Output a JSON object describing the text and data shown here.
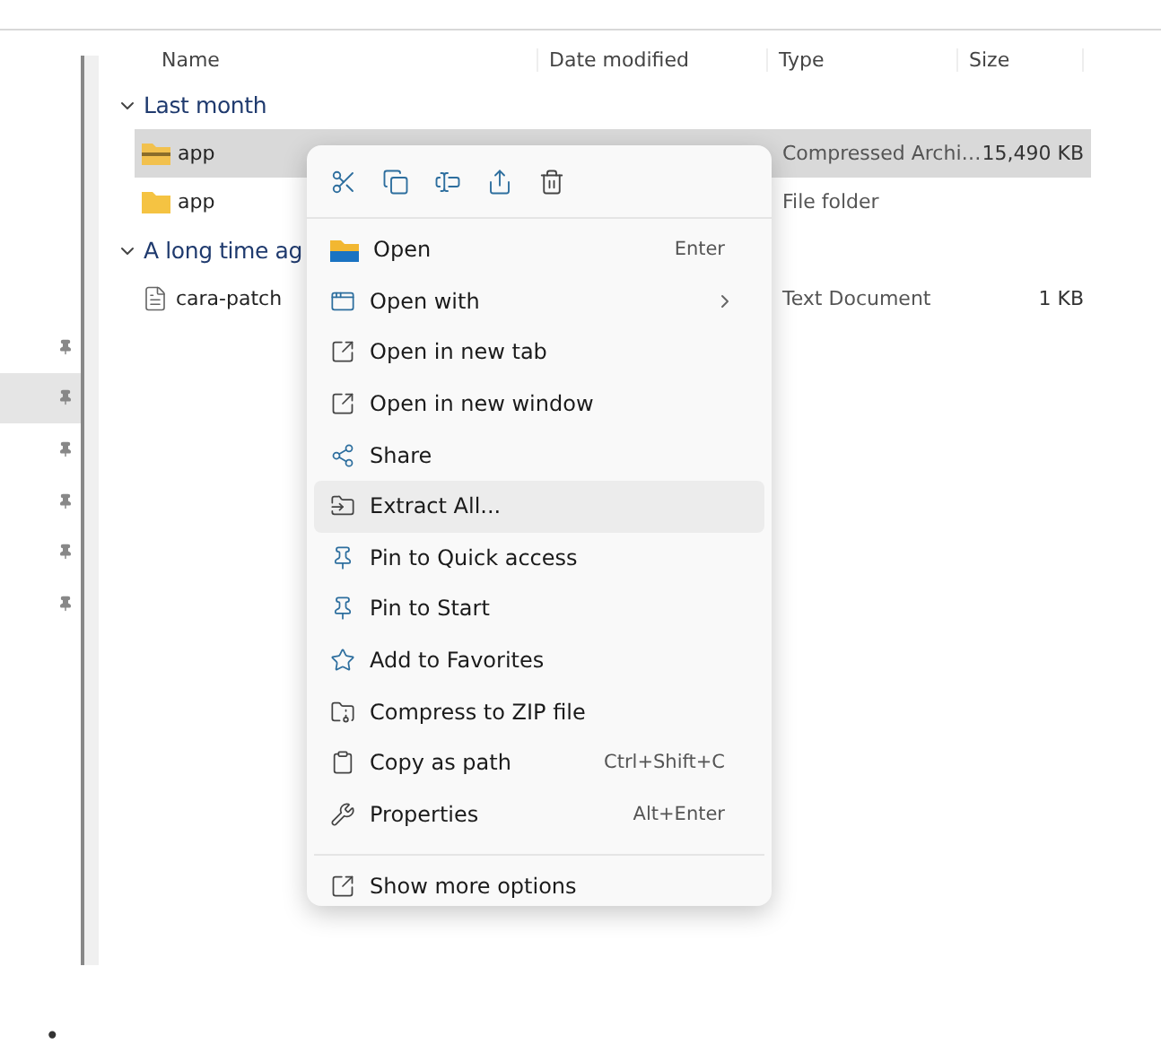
{
  "columns": [
    "Name",
    "Date modified",
    "Type",
    "Size"
  ],
  "groups": [
    {
      "label": "Last month",
      "expanded": true,
      "files": [
        {
          "name": "app",
          "kind": "zip",
          "type": "Compressed Archi…",
          "size": "15,490 KB",
          "selected": true
        },
        {
          "name": "app",
          "kind": "folder",
          "type": "File folder",
          "selected": false
        }
      ]
    },
    {
      "label": "A long time ag",
      "expanded": true,
      "files": [
        {
          "name": "cara-patch",
          "kind": "text",
          "type": "Text Document",
          "size": "1 KB",
          "selected": false
        }
      ]
    }
  ],
  "sidebar_pins": [
    {
      "selected": false
    },
    {
      "selected": true
    },
    {
      "selected": false
    },
    {
      "selected": false
    },
    {
      "selected": false
    },
    {
      "selected": false
    }
  ],
  "context_menu": {
    "toolbar": [
      {
        "kind": "cut"
      },
      {
        "kind": "copy"
      },
      {
        "kind": "rename"
      },
      {
        "kind": "share"
      },
      {
        "kind": "delete"
      }
    ],
    "items": [
      {
        "kind": "open",
        "label": "Open",
        "shortcut": "Enter",
        "highlighted": false
      },
      {
        "kind": "openwith",
        "label": "Open with",
        "submenu": true,
        "highlighted": false
      },
      {
        "kind": "newtab",
        "label": "Open in new tab",
        "highlighted": false
      },
      {
        "kind": "newwindow",
        "label": "Open in new window",
        "highlighted": false
      },
      {
        "kind": "share",
        "label": "Share",
        "highlighted": false
      },
      {
        "kind": "extract",
        "label": "Extract All...",
        "highlighted": true
      },
      {
        "kind": "pin",
        "label": "Pin to Quick access",
        "highlighted": false
      },
      {
        "kind": "pin",
        "label": "Pin to Start",
        "highlighted": false
      },
      {
        "kind": "star",
        "label": "Add to Favorites",
        "highlighted": false
      },
      {
        "kind": "zip",
        "label": "Compress to ZIP file",
        "highlighted": false
      },
      {
        "kind": "path",
        "label": "Copy as path",
        "shortcut": "Ctrl+Shift+C",
        "highlighted": false
      },
      {
        "kind": "wrench",
        "label": "Properties",
        "shortcut": "Alt+Enter",
        "highlighted": false
      }
    ],
    "more": {
      "label": "Show more options"
    }
  },
  "bullet": "•"
}
